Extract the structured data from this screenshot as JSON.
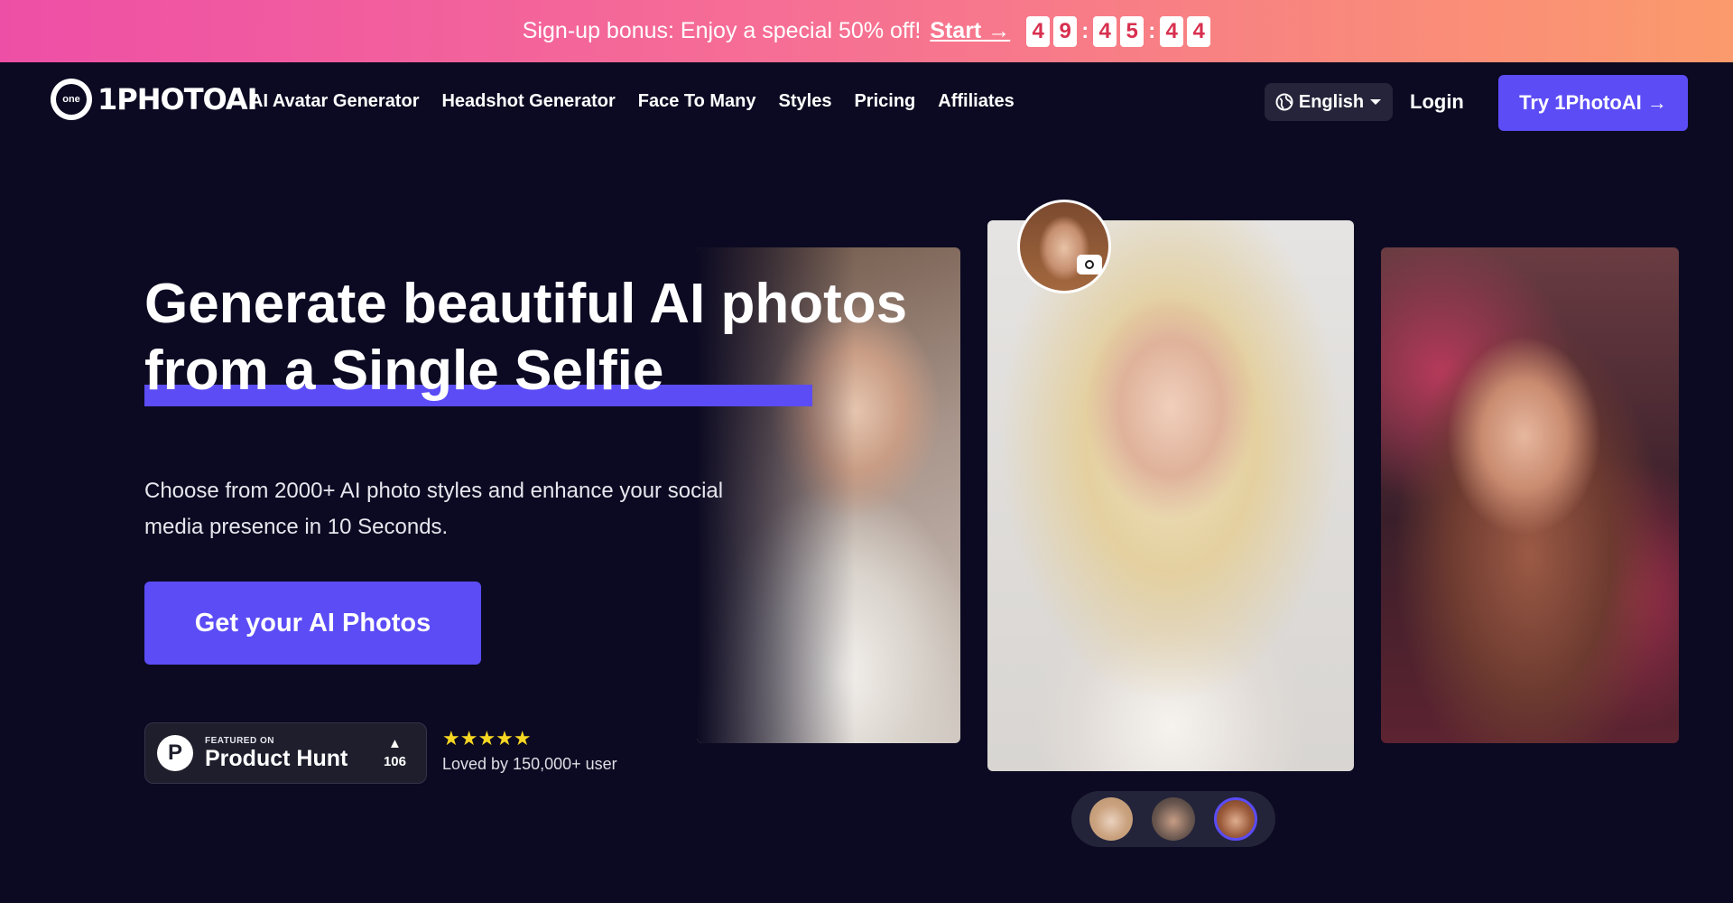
{
  "promo": {
    "text": "Sign-up bonus: Enjoy a special 50% off!",
    "start_label": "Start →",
    "countdown": [
      "4",
      "9",
      ":",
      "4",
      "5",
      ":",
      "4",
      "4"
    ]
  },
  "nav": {
    "logo_small": "one",
    "logo_text": "1PHOTOAI",
    "links": [
      "AI Avatar Generator",
      "Headshot Generator",
      "Face To Many",
      "Styles",
      "Pricing",
      "Affiliates"
    ],
    "language": "English",
    "login": "Login",
    "cta": "Try 1PhotoAI →"
  },
  "hero": {
    "headline_line1": "Generate beautiful AI photos",
    "headline_line2": "from a Single Selfie",
    "subtext": "Choose from 2000+ AI photo styles and enhance your social media presence in 10 Seconds.",
    "cta": "Get your AI Photos"
  },
  "product_hunt": {
    "featured": "FEATURED ON",
    "name": "Product Hunt",
    "logo_letter": "P",
    "votes": "106"
  },
  "rating": {
    "stars": "★★★★★",
    "loved_by": "Loved by 150,000+ user"
  },
  "colors": {
    "accent": "#5b4cf6",
    "background": "#0c0a22",
    "banner_start": "#ee4fa6",
    "banner_end": "#fb9a6c",
    "star": "#f7d722"
  }
}
